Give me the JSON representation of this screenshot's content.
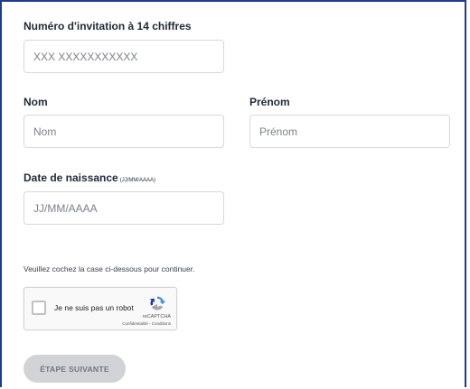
{
  "form": {
    "invitation": {
      "label": "Numéro d'invitation à 14 chiffres",
      "placeholder": "XXX XXXXXXXXXXX",
      "value": ""
    },
    "lastname": {
      "label": "Nom",
      "placeholder": "Nom",
      "value": ""
    },
    "firstname": {
      "label": "Prénom",
      "placeholder": "Prénom",
      "value": ""
    },
    "birthdate": {
      "label": "Date de naissance",
      "format_hint": "(JJ/MM/AAAA)",
      "placeholder": "JJ/MM/AAAA",
      "value": ""
    },
    "captcha_note": "Veuillez cochez la case ci-dessous pour continuer.",
    "recaptcha": {
      "label": "Je ne suis pas un robot",
      "brand": "reCAPTCHA",
      "links": "Confidentialité - Conditions",
      "checked": false
    },
    "next_button": {
      "label": "ÉTAPE SUIVANTE",
      "disabled": true
    }
  },
  "colors": {
    "frame_border": "#1f3b8a",
    "input_border": "#d5d9de",
    "button_disabled_bg": "#d1d3d6",
    "button_disabled_text": "#6f767e",
    "recaptcha_blue": "#4a90e2"
  }
}
